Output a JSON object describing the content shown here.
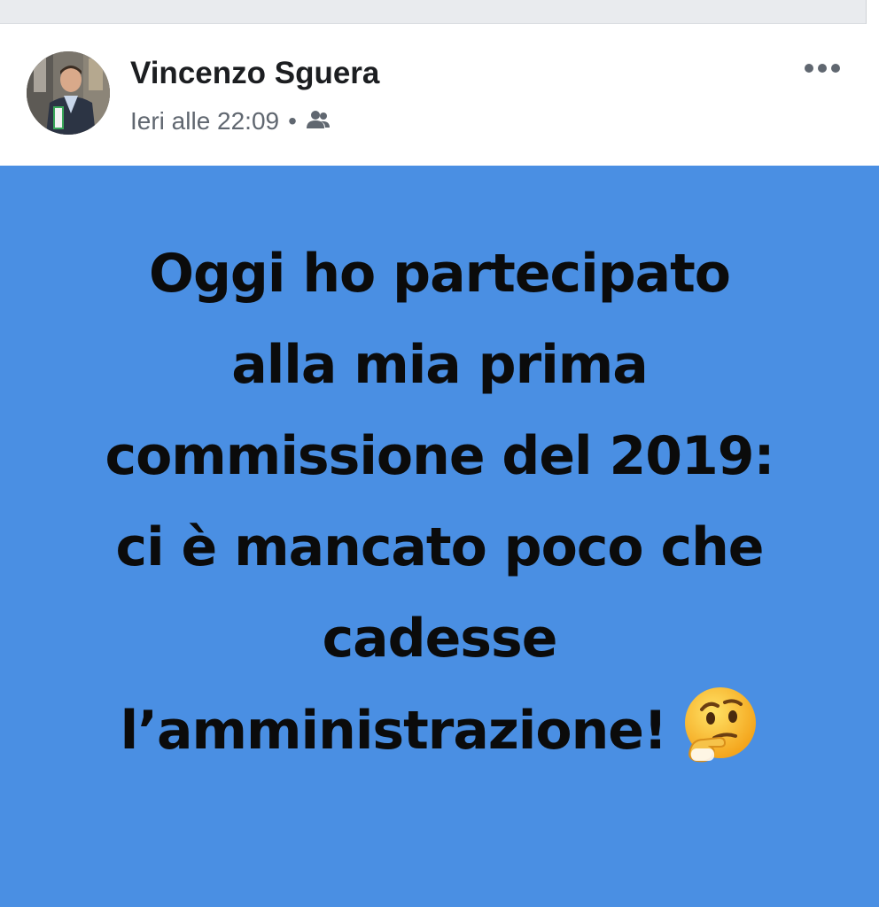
{
  "post": {
    "author": "Vincenzo Sguera",
    "timestamp": "Ieri alle 22:09",
    "separator": "•",
    "audience_icon": "friends-icon",
    "more_icon": "more-options-icon",
    "body_lines": [
      "Oggi ho partecipato",
      "alla mia prima",
      "commissione del 2019:",
      "ci è mancato poco che",
      "cadesse",
      "l’amministrazione!"
    ],
    "emoji": "thinking-face-emoji",
    "background_color": "#4a8fe3",
    "text_color": "#0b0b0b"
  }
}
